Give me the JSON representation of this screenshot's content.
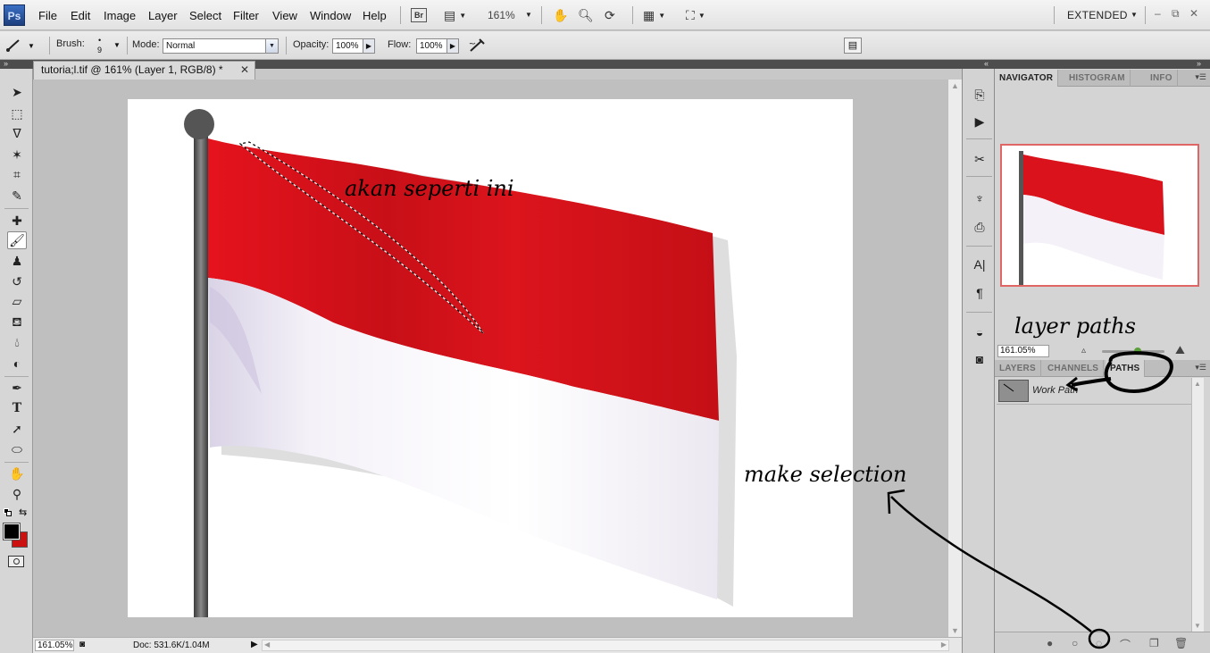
{
  "app": {
    "logo_text": "Ps",
    "menu": [
      "File",
      "Edit",
      "Image",
      "Layer",
      "Select",
      "Filter",
      "View",
      "Window",
      "Help"
    ],
    "bridge_label": "Br",
    "zoom_display": "161%",
    "workspace": "EXTENDED",
    "window_controls": [
      "–",
      "⧉",
      "✕"
    ]
  },
  "options_bar": {
    "brush_label": "Brush:",
    "brush_size": "9",
    "mode_label": "Mode:",
    "mode_value": "Normal",
    "opacity_label": "Opacity:",
    "opacity_value": "100%",
    "flow_label": "Flow:",
    "flow_value": "100%"
  },
  "document": {
    "tab_title": "tutoria;l.tif @ 161% (Layer 1, RGB/8) *",
    "status_zoom": "161.05%",
    "status_doc": "Doc: 531.6K/1.04M"
  },
  "panels": {
    "top_tabs": [
      "NAVIGATOR",
      "HISTOGRAM",
      "INFO"
    ],
    "navigator_zoom": "161.05%",
    "bottom_tabs": [
      "LAYERS",
      "CHANNELS",
      "PATHS"
    ],
    "paths": [
      {
        "name": "Work Path"
      }
    ]
  },
  "annotations": {
    "canvas_note": "akan seperti ini",
    "panel_note": "layer paths",
    "button_note": "make selection"
  },
  "colors": {
    "flag_red": "#d9121b",
    "flag_white": "#ffffff",
    "foreground": "#000000",
    "background": "#cc1111",
    "accent_highlight": "#e06565"
  }
}
